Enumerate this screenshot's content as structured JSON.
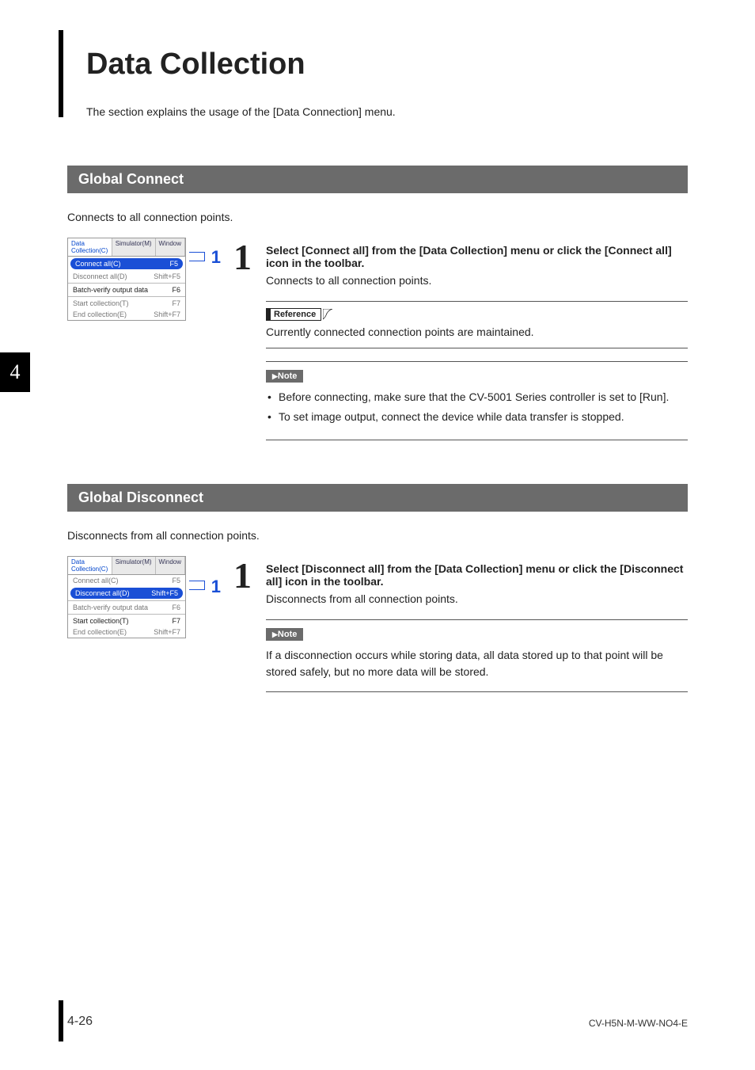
{
  "title": "Data Collection",
  "intro": "The section explains the usage of the [Data Connection] menu.",
  "chapter_tab": "4",
  "page_number": "4-26",
  "doc_code": "CV-H5N-M-WW-NO4-E",
  "sections": {
    "connect": {
      "heading": "Global Connect",
      "desc": "Connects to all connection points.",
      "callout": "1",
      "menu": {
        "tabs": [
          "Data Collection(C)",
          "Simulator(M)",
          "Window"
        ],
        "active_tab_index": 0,
        "items": [
          {
            "label": "Connect all(C)",
            "shortcut": "F5",
            "enabled": true,
            "highlight": true
          },
          {
            "label": "Disconnect all(D)",
            "shortcut": "Shift+F5",
            "enabled": false,
            "highlight": false
          },
          {
            "divider": true
          },
          {
            "label": "Batch-verify output data",
            "shortcut": "F6",
            "enabled": true,
            "highlight": false
          },
          {
            "divider": true
          },
          {
            "label": "Start collection(T)",
            "shortcut": "F7",
            "enabled": false,
            "highlight": false
          },
          {
            "label": "End collection(E)",
            "shortcut": "Shift+F7",
            "enabled": false,
            "highlight": false
          }
        ]
      },
      "step_num": "1",
      "step_title": "Select [Connect all] from the [Data Collection] menu or click the [Connect all] icon in the toolbar.",
      "step_desc": "Connects to all connection points.",
      "reference": {
        "label": "Reference",
        "text": "Currently connected connection points are maintained."
      },
      "note": {
        "label": "Note",
        "items": [
          "Before connecting, make sure that the CV-5001 Series controller is set to [Run].",
          "To set image output, connect the device while data transfer is stopped."
        ]
      }
    },
    "disconnect": {
      "heading": "Global Disconnect",
      "desc": "Disconnects from all connection points.",
      "callout": "1",
      "menu": {
        "tabs": [
          "Data Collection(C)",
          "Simulator(M)",
          "Window"
        ],
        "active_tab_index": 0,
        "items": [
          {
            "label": "Connect all(C)",
            "shortcut": "F5",
            "enabled": false,
            "highlight": false
          },
          {
            "label": "Disconnect all(D)",
            "shortcut": "Shift+F5",
            "enabled": true,
            "highlight": true
          },
          {
            "divider": true
          },
          {
            "label": "Batch-verify output data",
            "shortcut": "F6",
            "enabled": false,
            "highlight": false
          },
          {
            "divider": true
          },
          {
            "label": "Start collection(T)",
            "shortcut": "F7",
            "enabled": true,
            "highlight": false
          },
          {
            "label": "End collection(E)",
            "shortcut": "Shift+F7",
            "enabled": false,
            "highlight": false
          }
        ]
      },
      "step_num": "1",
      "step_title": "Select [Disconnect all] from the [Data Collection] menu or click the [Disconnect all] icon in the toolbar.",
      "step_desc": "Disconnects from all connection points.",
      "note": {
        "label": "Note",
        "text": "If a disconnection occurs while storing data, all data stored up to that point will be stored safely, but no more data will be stored."
      }
    }
  }
}
